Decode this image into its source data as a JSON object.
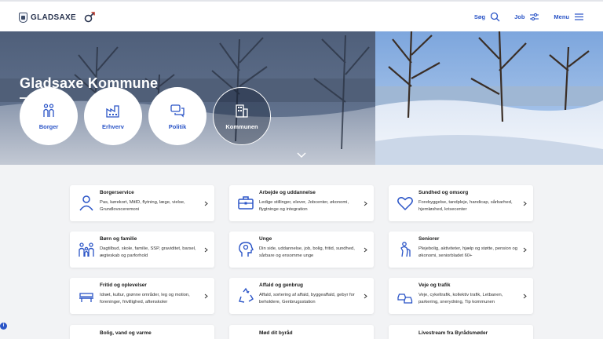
{
  "header": {
    "logo_text": "GLADSAXE",
    "nav": [
      {
        "label": "Søg",
        "icon": "search-icon"
      },
      {
        "label": "Job",
        "icon": "sliders-icon"
      },
      {
        "label": "Menu",
        "icon": "hamburger-icon"
      }
    ]
  },
  "hero": {
    "title": "Gladsaxe Kommune",
    "circles": [
      {
        "label": "Borger",
        "icon": "people-icon"
      },
      {
        "label": "Erhverv",
        "icon": "factory-icon"
      },
      {
        "label": "Politik",
        "icon": "speech-bubbles-icon"
      },
      {
        "label": "Kommunen",
        "icon": "building-icon"
      }
    ],
    "scroll_icon": "chevron-down-icon"
  },
  "cards": [
    {
      "title": "Borgerservice",
      "desc": "Pas, kørekort, MitID, flytning, læge, vielse, Grundlovsceremoni",
      "icon": "person-icon"
    },
    {
      "title": "Arbejde og uddannelse",
      "desc": "Ledige stillinger, elever, Jobcenter, økonomi, flygtninge og integration",
      "icon": "briefcase-icon"
    },
    {
      "title": "Sundhed og omsorg",
      "desc": "Forebyggelse, tandpleje, handicap, sårbarhed, hjemløshed, krisecenter",
      "icon": "heart-icon"
    },
    {
      "title": "Børn og familie",
      "desc": "Dagtilbud, skole, familie, SSP, graviditet, barsel, ægteskab og parforhold",
      "icon": "family-icon"
    },
    {
      "title": "Unge",
      "desc": "Din side, uddannelse, job, bolig, fritid, sundhed, sårbare og ensomme unge",
      "icon": "head-gear-icon"
    },
    {
      "title": "Seniorer",
      "desc": "Plejebolig, aktiviteter, hjælp og støtte, pension og økonomi, seniorbladet 60+",
      "icon": "senior-icon"
    },
    {
      "title": "Fritid og oplevelser",
      "desc": "Idræt, kultur, grønne områder, leg og motion, foreninger, frivillighed, aftenskoler",
      "icon": "bench-icon"
    },
    {
      "title": "Affald og genbrug",
      "desc": "Affald, sortering af affald, byggeaffald, gebyr for beholdere, Genbrugsstation",
      "icon": "recycle-icon"
    },
    {
      "title": "Veje og trafik",
      "desc": "Veje, cykeltrafik, kollektiv trafik, Letbanen, parkering, snerydning, Tip kommunen",
      "icon": "cars-icon"
    },
    {
      "title": "Bolig, vand og varme",
      "desc": "",
      "icon": ""
    },
    {
      "title": "Mød dit byråd",
      "desc": "",
      "icon": ""
    },
    {
      "title": "Livestream fra Byrådsmøder",
      "desc": "",
      "icon": ""
    }
  ],
  "colors": {
    "accent": "#2b55c7",
    "background": "#f2f3f5"
  }
}
